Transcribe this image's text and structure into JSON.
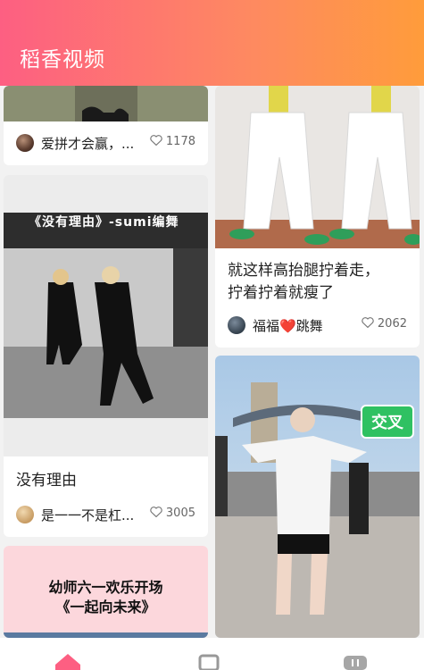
{
  "app": {
    "title": "稻香视频"
  },
  "cards": [
    {
      "author": "爱拼才会赢，...",
      "likes": "1178"
    },
    {
      "author": "福福❤️跳舞",
      "likes": "2062",
      "title_line1": "就这样高抬腿拧着走，",
      "title_line2": "拧着拧着就瘦了"
    },
    {
      "author": "是一一不是杠...",
      "likes": "3005",
      "title": "没有理由",
      "overlay": "《没有理由》-sumi编舞"
    },
    {
      "overlay": "交叉"
    },
    {
      "overlay_line1": "幼师六一欢乐开场",
      "overlay_line2": "《一起向未来》"
    }
  ],
  "tabbar": {
    "items": [
      "home-icon",
      "list-icon",
      "profile-icon"
    ],
    "active_color": "#fd5f82"
  }
}
